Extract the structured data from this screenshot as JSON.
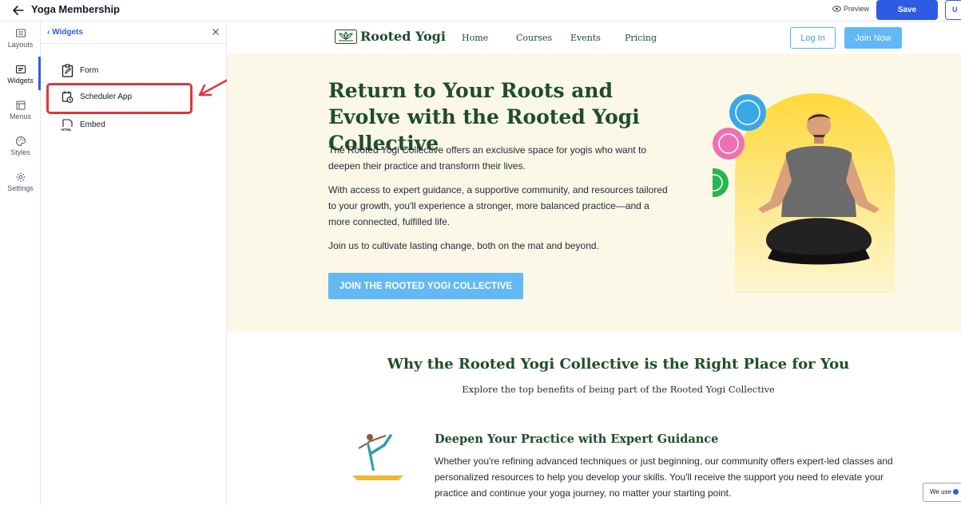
{
  "topbar": {
    "title": "Yoga Membership",
    "preview_label": "Preview",
    "save_label": "Save",
    "up_label": "U"
  },
  "rail": {
    "items": [
      {
        "label": "Layouts",
        "icon": "layouts-icon"
      },
      {
        "label": "Widgets",
        "icon": "widgets-icon",
        "active": true
      },
      {
        "label": "Menus",
        "icon": "menus-icon"
      },
      {
        "label": "Styles",
        "icon": "palette-icon"
      },
      {
        "label": "Settings",
        "icon": "gear-icon"
      }
    ]
  },
  "panel": {
    "back_label": "Widgets",
    "items": [
      {
        "label": "Form",
        "icon": "form-icon"
      },
      {
        "label": "Scheduler App",
        "icon": "calendar-clock-icon"
      },
      {
        "label": "Embed",
        "icon": "html-embed-icon"
      }
    ]
  },
  "site": {
    "logo_text": "Rooted Yogi",
    "nav": [
      "Home",
      "Courses",
      "Events",
      "Pricing"
    ],
    "login_label": "Log In",
    "join_now_label": "Join Now",
    "hero": {
      "title": "Return to Your Roots and Evolve with the Rooted Yogi Collective",
      "p1": "The Rooted Yogi Collective offers an exclusive space for yogis who want to deepen their practice and transform their lives.",
      "p2": "With access to expert guidance, a supportive community, and resources tailored to your growth, you'll experience a stronger, more balanced practice—and a more connected, fulfilled life.",
      "p3": "Join us to cultivate lasting change, both on the mat and beyond.",
      "cta": "JOIN THE ROOTED YOGI COLLECTIVE"
    },
    "why": {
      "title": "Why the Rooted Yogi Collective is the Right Place for You",
      "subtitle": "Explore the top benefits of being part of the Rooted Yogi Collective"
    },
    "feature": {
      "title": "Deepen Your Practice with Expert Guidance",
      "desc": "Whether you're refining advanced techniques or just beginning, our community offers expert-led classes and personalized resources to help you develop your skills. You'll receive the support you need to elevate your practice and continue your yoga journey, no matter your starting point."
    }
  },
  "cookie": {
    "label": "We use"
  },
  "colors": {
    "brand_blue": "#2f5be3",
    "site_green": "#1e4d2b",
    "hero_bg": "#fbf8e8",
    "cta_blue": "#63b9f3",
    "highlight_red": "#e0353a"
  }
}
